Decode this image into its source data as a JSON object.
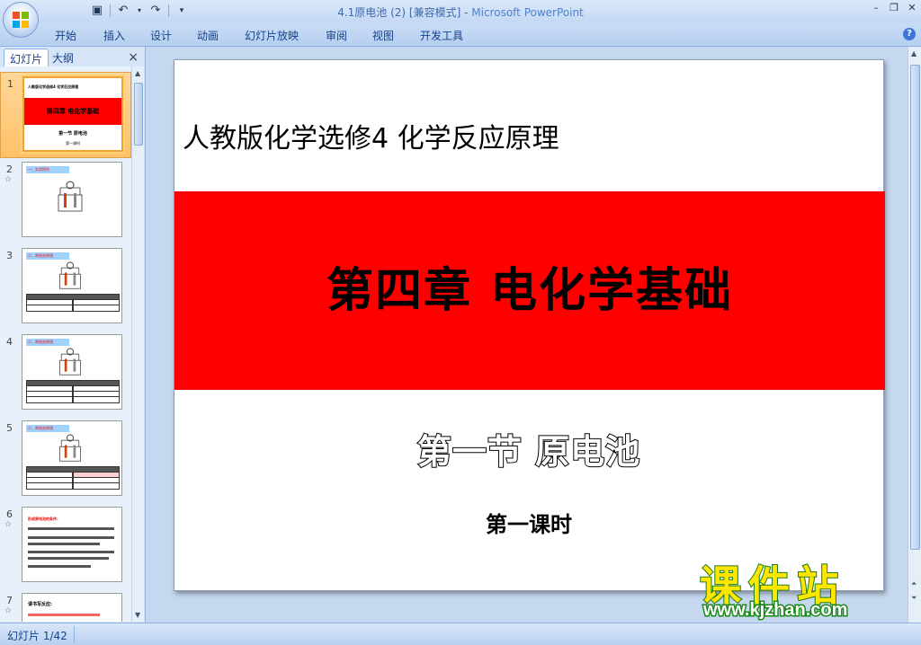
{
  "window": {
    "title": "4.1原电池 (2) [兼容模式]",
    "app_name": "Microsoft PowerPoint",
    "title_separator": " - "
  },
  "quick_access": {
    "icons": [
      "save-icon",
      "undo-icon",
      "redo-icon",
      "customize-icon"
    ]
  },
  "ribbon_tabs": [
    "开始",
    "插入",
    "设计",
    "动画",
    "幻灯片放映",
    "审阅",
    "视图",
    "开发工具"
  ],
  "panel": {
    "tab_slides": "幻灯片",
    "tab_outline": "大纲",
    "close": "×"
  },
  "thumbnails": [
    {
      "num": "1",
      "anim": "",
      "title": "人教版化学选修4 化学反应原理",
      "band": "第四章 电化学基础",
      "sub": "第一节 原电池",
      "sub2": "第一课时"
    },
    {
      "num": "2",
      "anim": "☆",
      "head": "一、实验探究"
    },
    {
      "num": "3",
      "anim": "",
      "head": "二、原电池原理"
    },
    {
      "num": "4",
      "anim": "",
      "head": "二、原电池原理"
    },
    {
      "num": "5",
      "anim": "",
      "head": "二、原电池原理"
    },
    {
      "num": "6",
      "anim": "☆",
      "head": "形成原电池的条件:"
    },
    {
      "num": "7",
      "anim": "☆",
      "head": "请书写反应:"
    }
  ],
  "slide": {
    "title": "人教版化学选修4 化学反应原理",
    "band_text": "第四章 电化学基础",
    "subtitle": "第一节 原电池",
    "subtitle2": "第一课时"
  },
  "watermark": {
    "big": "课件站",
    "url": "www.kjzhan.com"
  },
  "status": {
    "slide_info": "幻灯片 1/42"
  },
  "colors": {
    "band_red": "#ff0000",
    "ribbon_blue": "#bfdbff",
    "selection_orange": "#ffc168"
  }
}
